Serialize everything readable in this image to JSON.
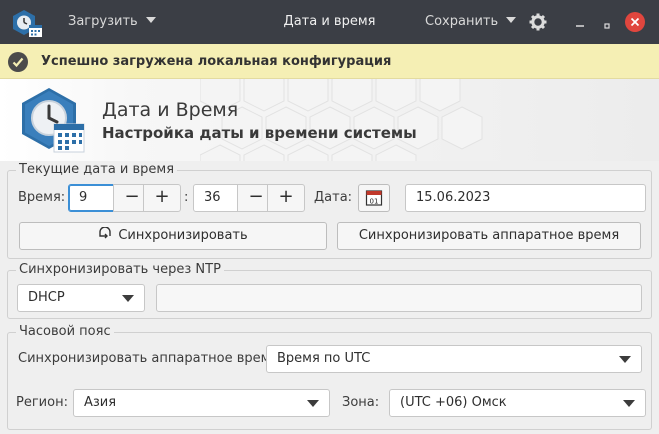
{
  "titlebar": {
    "load_label": "Загрузить",
    "title": "Дата и время",
    "save_label": "Сохранить"
  },
  "notification": {
    "text": "Успешно загружена локальная конфигурация"
  },
  "header": {
    "title": "Дата и Время",
    "subtitle": "Настройка даты и времени системы",
    "calendar_day": "01"
  },
  "current": {
    "group_title": "Текущие дата и время",
    "time_label": "Время:",
    "hours": "9",
    "separator": ":",
    "minutes": "36",
    "minus": "−",
    "plus": "+",
    "date_label": "Дата:",
    "date": "15.06.2023",
    "sync_button": "Синхронизировать",
    "sync_hw_button": "Синхронизировать аппаратное время"
  },
  "ntp": {
    "group_title": "Синхронизировать через NTP",
    "mode": "DHCP",
    "server": ""
  },
  "timezone": {
    "group_title": "Часовой пояс",
    "hw_label": "Синхронизировать аппаратное время:",
    "hw_value": "Время по UTC",
    "region_label": "Регион:",
    "region_value": "Азия",
    "zone_label": "Зона:",
    "zone_value": "(UTC +06) Омск"
  },
  "colors": {
    "accent": "#3b8fd6",
    "titlebar": "#3b3e45",
    "notification": "#f5efb4",
    "close": "#e0463e"
  }
}
